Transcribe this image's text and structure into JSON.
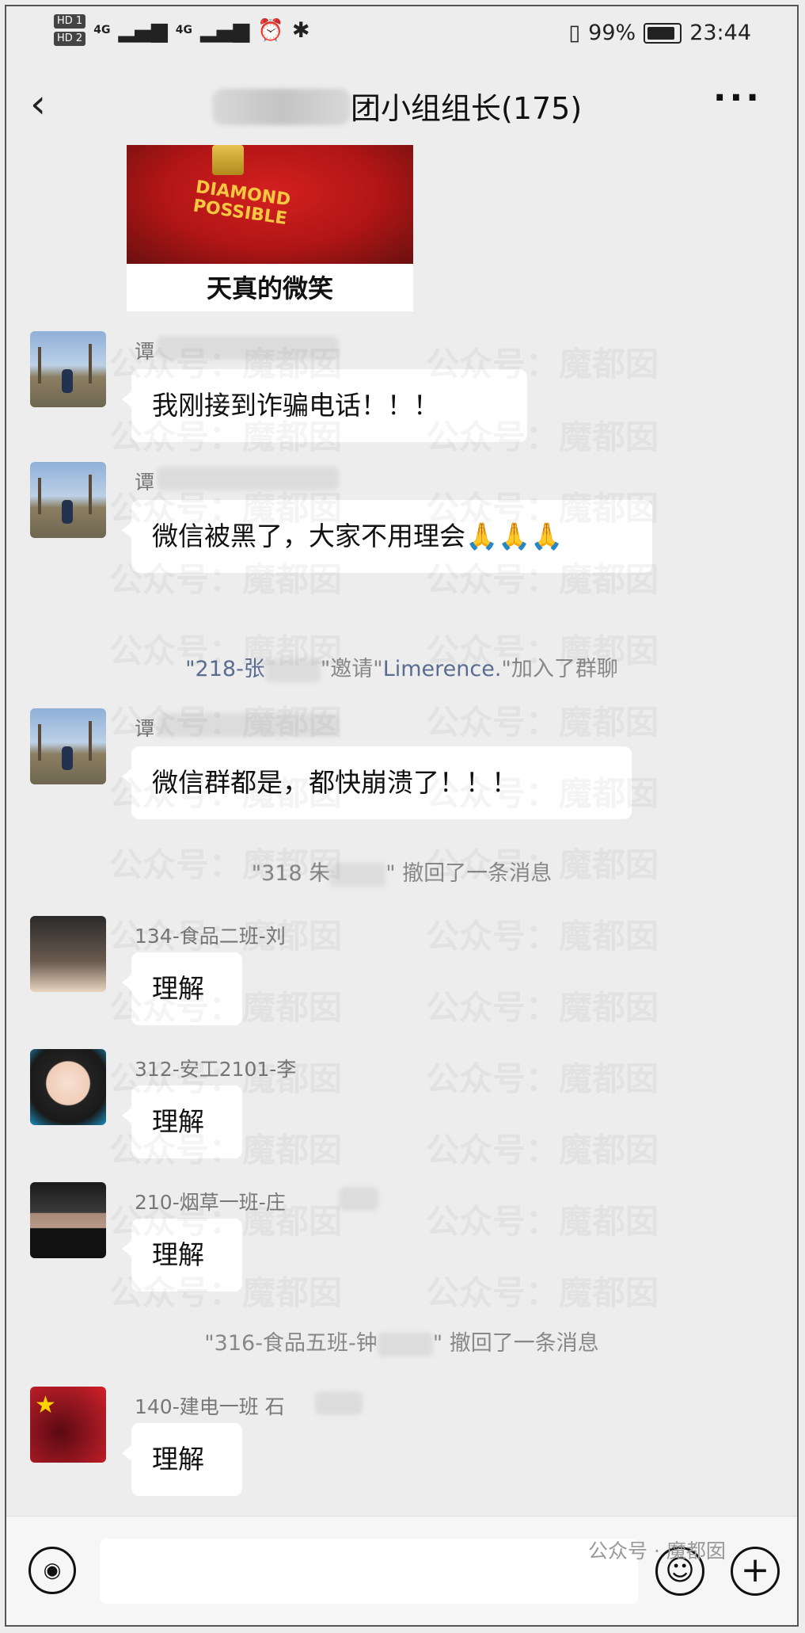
{
  "status_bar": {
    "hd1": "HD 1",
    "hd2": "HD 2",
    "net1": "4G",
    "net2": "4G",
    "battery": "99%",
    "time": "23:44"
  },
  "header": {
    "title": "团小组组长(175)",
    "more_label": "···"
  },
  "sticker": {
    "shirt_text": "DIAMOND\nPOSSIBLE",
    "caption": "天真的微笑"
  },
  "messages": [
    {
      "sender": "谭",
      "text": "我刚接到诈骗电话！！！"
    },
    {
      "sender": "谭",
      "text": "微信被黑了，大家不用理会🙏🙏🙏"
    },
    {
      "sender": "谭",
      "text": "微信群都是，都快崩溃了！！！"
    },
    {
      "sender": "134-食品二班-刘",
      "text": "理解"
    },
    {
      "sender": "312-安工2101-李",
      "text": "理解"
    },
    {
      "sender": "210-烟草一班-庄",
      "text": "理解"
    },
    {
      "sender": "140-建电一班 石",
      "text": "理解"
    }
  ],
  "system": {
    "invite_prefix": "\"218-张",
    "invite_mid": "\"邀请\"",
    "invite_name": "Limerence.",
    "invite_suffix": "\"加入了群聊",
    "recall1_prefix": "\"318 朱",
    "recall1_suffix": "\" 撤回了一条消息",
    "recall2_prefix": "\"316-食品五班-钟",
    "recall2_suffix": "\" 撤回了一条消息"
  },
  "watermark": {
    "text": "公众号：魔都囡",
    "footer": "公众号 · 魔都囡"
  },
  "input_bar": {
    "voice_icon": "voice-icon",
    "emoji_icon": "emoji-icon",
    "plus_icon": "plus-icon"
  }
}
